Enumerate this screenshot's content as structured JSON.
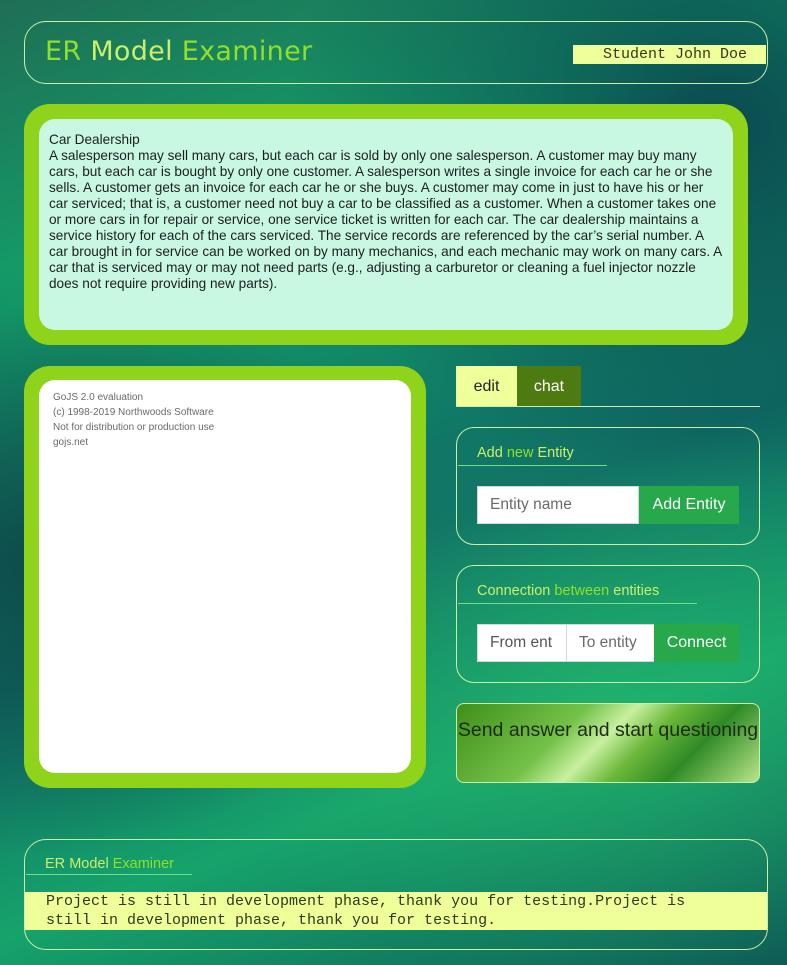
{
  "header": {
    "brand_part1": "ER",
    "brand_part2": "Model",
    "brand_part3": "Examiner",
    "student": "Student John Doe"
  },
  "task": {
    "title": "Car Dealership",
    "description": "A salesperson may sell many cars, but each car is sold by only one salesperson. A customer may buy many cars, but each car is bought by only one customer. A salesperson writes a single invoice for each car he or she sells. A customer gets an invoice for each car he or she buys. A customer may come in just to have his or her car serviced; that is, a customer need not buy a car to be classified as a customer. When a customer takes one or more cars in for repair or service, one service ticket is written for each car. The car dealership maintains a service history for each of the cars serviced. The service records are referenced by the car’s serial number. A car brought in for service can be worked on by many mechanics, and each mechanic may work on many cars. A car that is serviced may or may not need parts (e.g., adjusting a carburetor or cleaning a fuel injector nozzle does not require providing new parts)."
  },
  "diagram": {
    "watermark_lines": [
      "GoJS 2.0 evaluation",
      "(c) 1998-2019 Northwoods Software",
      "Not for distribution or production use",
      "gojs.net"
    ]
  },
  "tabs": [
    {
      "label": "edit"
    },
    {
      "label": "chat"
    }
  ],
  "add_entity": {
    "title_part1": "Add",
    "title_part2": "new",
    "title_part3": "Entity",
    "placeholder": "Entity name",
    "button": "Add Entity"
  },
  "connection": {
    "title_part1": "Connection",
    "title_part2": "between",
    "title_part3": "entities",
    "from_value": "From ent",
    "to_placeholder": "To entity",
    "button": "Connect"
  },
  "send_button": "Send answer and start questioning",
  "footer": {
    "title_part1": "ER",
    "title_part2": "Model",
    "title_part3": "Examiner",
    "message": "Project is still in development phase, thank you for testing.Project is still in development phase, thank you for testing."
  },
  "colors": {
    "accent_green": "#8fd31a",
    "highlight_yellow": "#efff99",
    "button_green": "#27a84a",
    "task_background": "#c8f8e2"
  }
}
